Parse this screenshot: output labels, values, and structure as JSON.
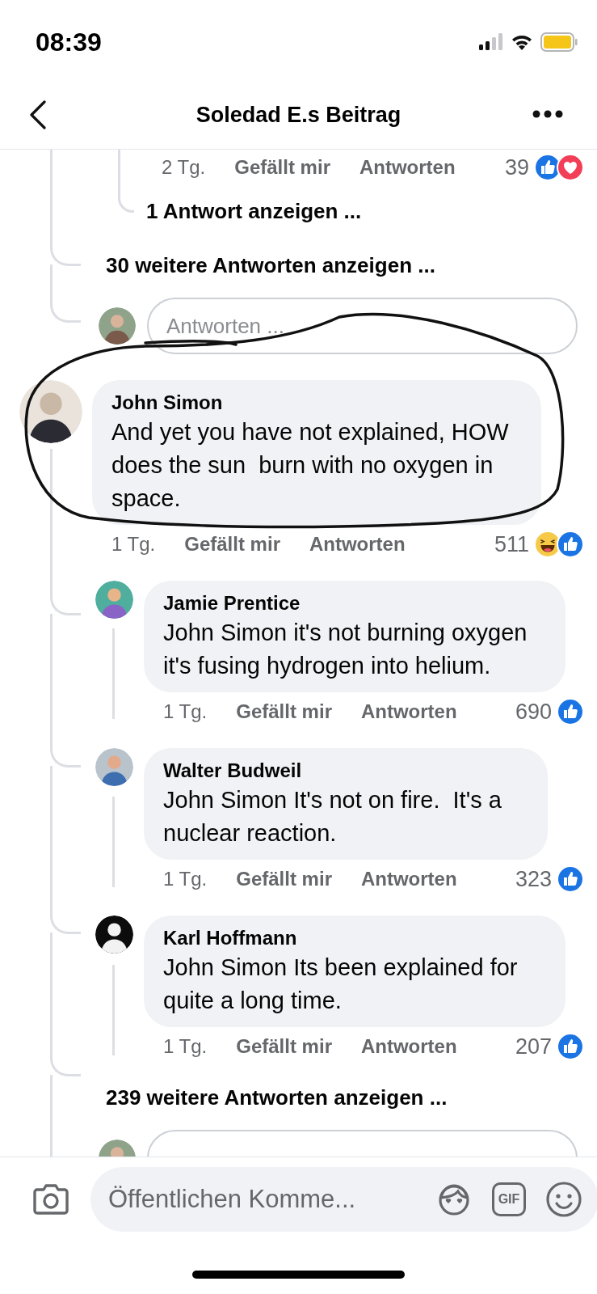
{
  "status_bar": {
    "time": "08:39"
  },
  "header": {
    "title": "Soledad E.s Beitrag"
  },
  "earlier_thread": {
    "reply_actions": {
      "time": "2 Tg.",
      "like": "Gefällt mir",
      "reply": "Antworten",
      "count": "39",
      "reactions": [
        {
          "kind": "like"
        },
        {
          "kind": "love"
        }
      ]
    },
    "show_reply_link": "1 Antwort anzeigen ...",
    "more_replies_link": "30 weitere Antworten anzeigen ...",
    "reply_field": {
      "placeholder": "Antworten ..."
    }
  },
  "comment": {
    "author": "John Simon",
    "text": "And yet you have not explained, HOW does the sun  burn with no oxygen in space.",
    "actions": {
      "time": "1 Tg.",
      "like": "Gefällt mir",
      "reply": "Antworten",
      "count": "511",
      "reactions": [
        {
          "kind": "haha"
        },
        {
          "kind": "like"
        }
      ]
    },
    "replies": [
      {
        "author": "Jamie Prentice",
        "text": "John Simon it's not burning oxygen it's fusing hydrogen into helium.",
        "actions": {
          "time": "1 Tg.",
          "like": "Gefällt mir",
          "reply": "Antworten",
          "count": "690",
          "reactions": [
            {
              "kind": "like"
            }
          ]
        }
      },
      {
        "author": "Walter Budweil",
        "text": "John Simon It's not on fire.  It's a nuclear reaction.",
        "actions": {
          "time": "1 Tg.",
          "like": "Gefällt mir",
          "reply": "Antworten",
          "count": "323",
          "reactions": [
            {
              "kind": "like"
            }
          ]
        }
      },
      {
        "author": "Karl Hoffmann",
        "text": "John Simon Its been explained for quite a long time.",
        "actions": {
          "time": "1 Tg.",
          "like": "Gefällt mir",
          "reply": "Antworten",
          "count": "207",
          "reactions": [
            {
              "kind": "like"
            }
          ]
        }
      }
    ],
    "more_replies_link": "239 weitere Antworten anzeigen ..."
  },
  "composer": {
    "placeholder": "Öffentlichen Komme...",
    "gif_button": "GIF"
  }
}
